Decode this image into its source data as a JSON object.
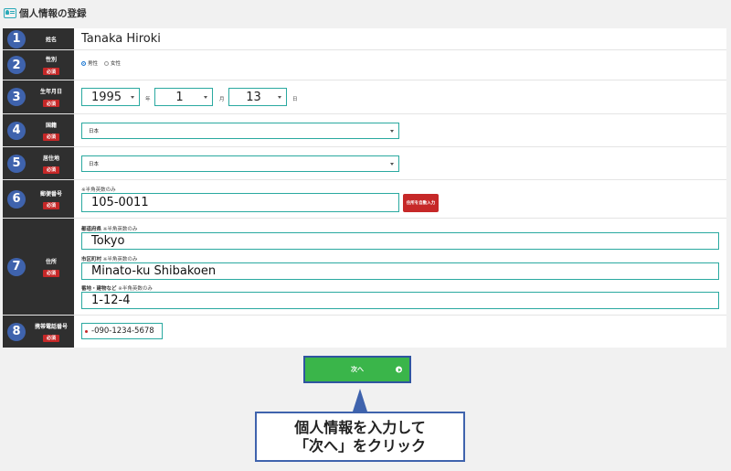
{
  "header": {
    "title": "個人情報の登録",
    "icon": "id-card-icon"
  },
  "fields": {
    "name": {
      "num": "1",
      "label": "姓名",
      "value": "Tanaka Hiroki"
    },
    "gender": {
      "num": "2",
      "label": "性別",
      "required": "必須",
      "options": [
        "男性",
        "女性"
      ],
      "selected": "男性"
    },
    "birthdate": {
      "num": "3",
      "label": "生年月日",
      "required": "必須",
      "year": "1995",
      "year_unit": "年",
      "month": "1",
      "month_unit": "月",
      "day": "13",
      "day_unit": "日"
    },
    "nationality": {
      "num": "4",
      "label": "国籍",
      "required": "必須",
      "value": "日本"
    },
    "residence": {
      "num": "5",
      "label": "居住地",
      "required": "必須",
      "value": "日本"
    },
    "postal": {
      "num": "6",
      "label": "郵便番号",
      "required": "必須",
      "note": "※半角英数のみ",
      "value": "105-0011",
      "button": "住所を自動入力"
    },
    "address": {
      "num": "7",
      "label": "住所",
      "required": "必須",
      "prefecture_label": "都道府県",
      "prefecture_note": "※半角英数のみ",
      "prefecture": "Tokyo",
      "city_label": "市区町村",
      "city_note": "※半角英数のみ",
      "city": "Minato-ku  Shibakoen",
      "street_label": "番地・建物など",
      "street_note": "※半角英数のみ",
      "street": "1-12-4"
    },
    "phone": {
      "num": "8",
      "label": "携帯電話番号",
      "required": "必須",
      "value": "-090-1234-5678"
    }
  },
  "next_button": {
    "label": "次へ"
  },
  "callout": {
    "line1": "個人情報を入力して",
    "line2": "「次へ」をクリック"
  },
  "colors": {
    "label_bg": "#2f2f2f",
    "badge": "#3f63ad",
    "required": "#c62828",
    "input_border": "#2aa9a0",
    "next_button": "#3ab54a"
  }
}
